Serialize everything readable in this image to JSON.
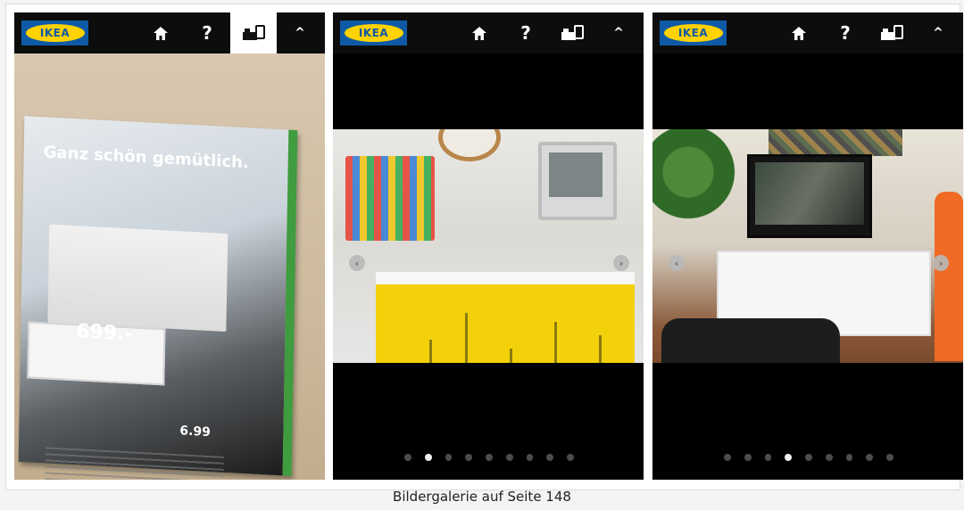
{
  "brand": {
    "logo_text": "IKEA",
    "logo_blue": "#0f5aa6",
    "logo_yellow": "#ffd200"
  },
  "toolbar": {
    "home_icon": "home-icon",
    "help_label": "?",
    "scan_icon": "catalog-scan-icon",
    "collapse_label": "^"
  },
  "screens": [
    {
      "active_button": "scan",
      "catalog_title": "Ganz schön gemütlich.",
      "price_big": "699.-",
      "price_small": "6.99"
    },
    {
      "dots_total": 9,
      "active_dot": 2
    },
    {
      "dots_total": 9,
      "active_dot": 4
    }
  ],
  "caption": "Bildergalerie auf Seite 148"
}
